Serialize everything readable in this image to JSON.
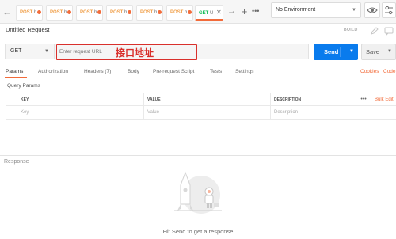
{
  "tabs": [
    {
      "method": "POST",
      "name": "h",
      "modified": true
    },
    {
      "method": "POST",
      "name": "h",
      "modified": true
    },
    {
      "method": "POST",
      "name": "h",
      "modified": true
    },
    {
      "method": "POST",
      "name": "h",
      "modified": true
    },
    {
      "method": "POST",
      "name": "h",
      "modified": true
    },
    {
      "method": "POST",
      "name": "h",
      "modified": true
    },
    {
      "method": "GET",
      "name": "U",
      "active": true
    }
  ],
  "environment": {
    "selected": "No Environment"
  },
  "request": {
    "title": "Untitled Request",
    "build_label": "BUILD",
    "method": "GET",
    "url_placeholder": "Enter request URL",
    "url_value": "",
    "annotation": "接口地址",
    "send_label": "Send",
    "save_label": "Save"
  },
  "request_tabs": {
    "items": [
      {
        "label": "Params",
        "active": true
      },
      {
        "label": "Authorization"
      },
      {
        "label": "Headers (7)"
      },
      {
        "label": "Body"
      },
      {
        "label": "Pre-request Script"
      },
      {
        "label": "Tests"
      },
      {
        "label": "Settings"
      }
    ],
    "cookies_label": "Cookies",
    "code_label": "Code"
  },
  "query_params": {
    "title": "Query Params",
    "columns": [
      "KEY",
      "VALUE",
      "DESCRIPTION"
    ],
    "placeholders": [
      "Key",
      "Value",
      "Description"
    ],
    "more_label": "•••",
    "bulk_edit_label": "Bulk Edit"
  },
  "response": {
    "label": "Response",
    "hint": "Hit Send to get a response"
  },
  "colors": {
    "accent": "#f26b3a",
    "send": "#097bed",
    "annotation": "#d9302c",
    "get": "#0cbb52",
    "post": "#f0a04b"
  }
}
